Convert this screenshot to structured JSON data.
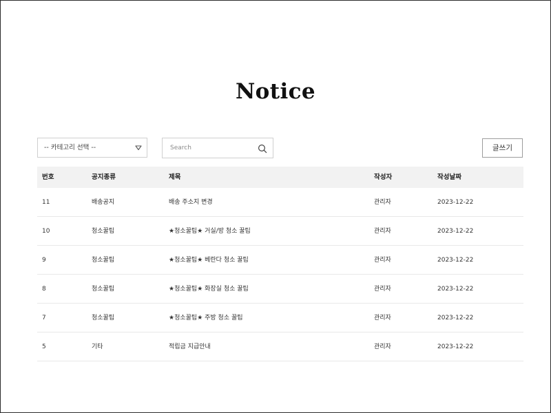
{
  "page": {
    "title": "Notice"
  },
  "controls": {
    "category_select_value": "-- 카테고리 선택 --",
    "search_placeholder": "Search",
    "write_button_label": "글쓰기"
  },
  "table": {
    "headers": {
      "number": "번호",
      "type": "공지종류",
      "title": "제목",
      "writer": "작성자",
      "date": "작성날짜"
    },
    "rows": [
      {
        "number": "11",
        "type": "배송공지",
        "title": "배송 주소지 변경",
        "writer": "관리자",
        "date": "2023-12-22"
      },
      {
        "number": "10",
        "type": "청소꿀팁",
        "title": "★청소꿀팁★ 거실/방 청소 꿀팁",
        "writer": "관리자",
        "date": "2023-12-22"
      },
      {
        "number": "9",
        "type": "청소꿀팁",
        "title": "★청소꿀팁★ 베란다 청소 꿀팁",
        "writer": "관리자",
        "date": "2023-12-22"
      },
      {
        "number": "8",
        "type": "청소꿀팁",
        "title": "★청소꿀팁★ 화장실 청소 꿀팁",
        "writer": "관리자",
        "date": "2023-12-22"
      },
      {
        "number": "7",
        "type": "청소꿀팁",
        "title": "★청소꿀팁★ 주방 청소 꿀팁",
        "writer": "관리자",
        "date": "2023-12-22"
      },
      {
        "number": "5",
        "type": "기타",
        "title": "적립금 지급안내",
        "writer": "관리자",
        "date": "2023-12-22"
      }
    ]
  },
  "icons": {
    "dropdown": "chevron-down-icon",
    "search": "search-icon"
  }
}
